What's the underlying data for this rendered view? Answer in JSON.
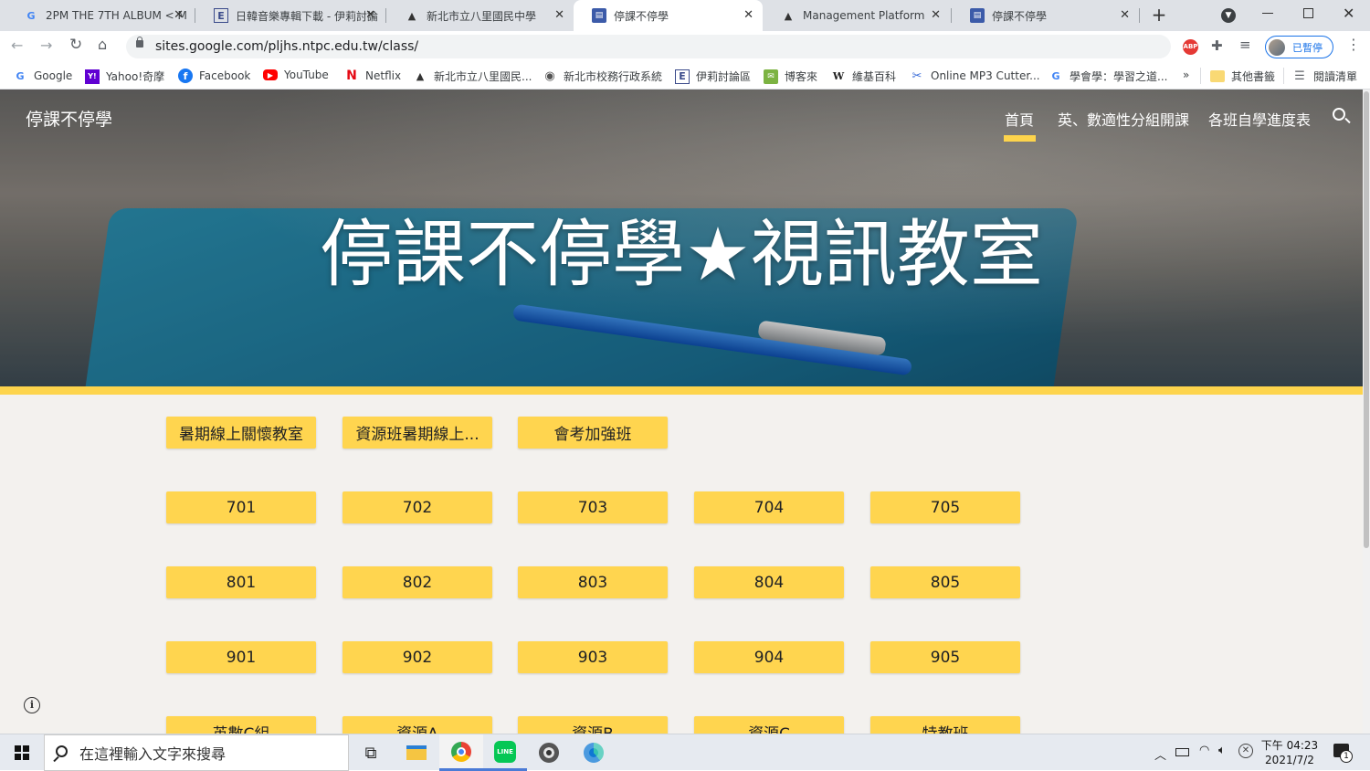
{
  "browser": {
    "tabs": [
      {
        "title": "2PM THE 7TH ALBUM < M",
        "favicon": "G",
        "active": false
      },
      {
        "title": "日韓音樂專輯下載 - 伊莉討論",
        "favicon": "E",
        "active": false
      },
      {
        "title": "新北市立八里國民中學",
        "favicon": "school-logo",
        "active": false
      },
      {
        "title": "停課不停學",
        "favicon": "sites-logo",
        "active": true
      },
      {
        "title": "Management Platform",
        "favicon": "school-logo",
        "active": false
      },
      {
        "title": "停課不停學",
        "favicon": "sites-logo",
        "active": false
      }
    ],
    "url": "sites.google.com/pljhs.ntpc.edu.tw/class/",
    "profile_label": "已暫停",
    "extension_badge": "ABP",
    "bookmarks": [
      {
        "label": "Google",
        "icon": "G",
        "color": "#4285f4"
      },
      {
        "label": "Yahoo!奇摩",
        "icon": "Y!",
        "color": "#6001d2"
      },
      {
        "label": "Facebook",
        "icon": "f",
        "color": "#1877f2"
      },
      {
        "label": "YouTube",
        "icon": "▶",
        "color": "#ff0000"
      },
      {
        "label": "Netflix",
        "icon": "N",
        "color": "#e50914"
      },
      {
        "label": "新北市立八里國民...",
        "icon": "▲",
        "color": "#333333"
      },
      {
        "label": "新北市校務行政系統",
        "icon": "◉",
        "color": "#555555"
      },
      {
        "label": "伊莉討論區",
        "icon": "E",
        "color": "#3a4a8a"
      },
      {
        "label": "博客來",
        "icon": "✉",
        "color": "#7cb342"
      },
      {
        "label": "維基百科",
        "icon": "W",
        "color": "#222222"
      },
      {
        "label": "Online MP3 Cutter...",
        "icon": "✂",
        "color": "#3b6dd8"
      },
      {
        "label": "學會學：學習之道...",
        "icon": "G",
        "color": "#4285f4"
      }
    ],
    "bookmarks_more": "»",
    "other_bookmarks": "其他書籤",
    "reading_list": "閱讀清單"
  },
  "site": {
    "logo_title": "停課不停學",
    "nav": [
      "首頁",
      "英、數適性分組開課",
      "各班自學進度表"
    ],
    "active_nav": "首頁",
    "hero_title": "停課不停學★視訊教室",
    "button_rows": [
      [
        "暑期線上關懷教室",
        "資源班暑期線上...",
        "會考加強班"
      ],
      [
        "701",
        "702",
        "703",
        "704",
        "705"
      ],
      [
        "801",
        "802",
        "803",
        "804",
        "805"
      ],
      [
        "901",
        "902",
        "903",
        "904",
        "905"
      ],
      [
        "英數C組",
        "資源A",
        "資源B",
        "資源C",
        "特教班"
      ]
    ],
    "accent_color": "#fdd44c",
    "button_color": "#ffd54f"
  },
  "taskbar": {
    "search_placeholder": "在這裡輸入文字來搜尋",
    "time": "下午 04:23",
    "date": "2021/7/2",
    "notification_count": "1",
    "pinned_apps": [
      "task-view",
      "file-explorer",
      "chrome",
      "line",
      "music-player",
      "edge"
    ]
  }
}
